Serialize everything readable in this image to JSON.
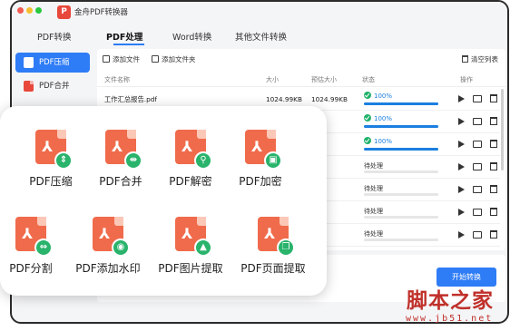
{
  "app": {
    "title": "金舟PDF转换器",
    "logo_text": "P"
  },
  "tabs": [
    {
      "label": "PDF转换"
    },
    {
      "label": "PDF处理"
    },
    {
      "label": "Word转换"
    },
    {
      "label": "其他文件转换"
    }
  ],
  "sidebar": {
    "items": [
      {
        "label": "PDF压缩"
      },
      {
        "label": "PDF合并"
      }
    ]
  },
  "toolbar": {
    "add_file": "添加文件",
    "add_folder": "添加文件夹",
    "clear_list": "清空列表"
  },
  "table": {
    "headers": {
      "name": "文件名称",
      "size": "大小",
      "est_size": "预估大小",
      "status": "状态",
      "ops": "操作"
    },
    "rows": [
      {
        "name": "工作汇总报告.pdf",
        "size": "1024.99KB",
        "est_size": "1024.99KB",
        "status": "100%",
        "progress": 100,
        "done": true
      },
      {
        "name": "",
        "size": "",
        "est_size": "KB",
        "status": "100%",
        "progress": 100,
        "done": true
      },
      {
        "name": "",
        "size": "",
        "est_size": "KB",
        "status": "100%",
        "progress": 100,
        "done": true
      },
      {
        "name": "",
        "size": "",
        "est_size": "",
        "status": "待处理",
        "progress": 0,
        "done": false
      },
      {
        "name": "",
        "size": "",
        "est_size": "",
        "status": "待处理",
        "progress": 0,
        "done": false
      },
      {
        "name": "",
        "size": "",
        "est_size": "",
        "status": "待处理",
        "progress": 0,
        "done": false
      },
      {
        "name": "",
        "size": "",
        "est_size": "",
        "status": "待处理",
        "progress": 0,
        "done": false
      }
    ]
  },
  "start_button": "开始转换",
  "tools": [
    {
      "label": "PDF压缩",
      "badge": "⇕"
    },
    {
      "label": "PDF合并",
      "badge": "⇹"
    },
    {
      "label": "PDF解密",
      "badge": "⚲"
    },
    {
      "label": "PDF加密",
      "badge": "▣"
    },
    {
      "label": "PDF分割",
      "badge": "⇔"
    },
    {
      "label": "PDF添加水印",
      "badge": "◉"
    },
    {
      "label": "PDF图片提取",
      "badge": "▲"
    },
    {
      "label": "PDF页面提取",
      "badge": "❐"
    }
  ],
  "watermark": {
    "text": "脚本之家",
    "url": "www.jb51.net"
  },
  "colors": {
    "accent": "#2e7cf6",
    "pdf_orange": "#f06b4b",
    "badge_green": "#29b36b",
    "watermark_red": "#c0302a"
  }
}
